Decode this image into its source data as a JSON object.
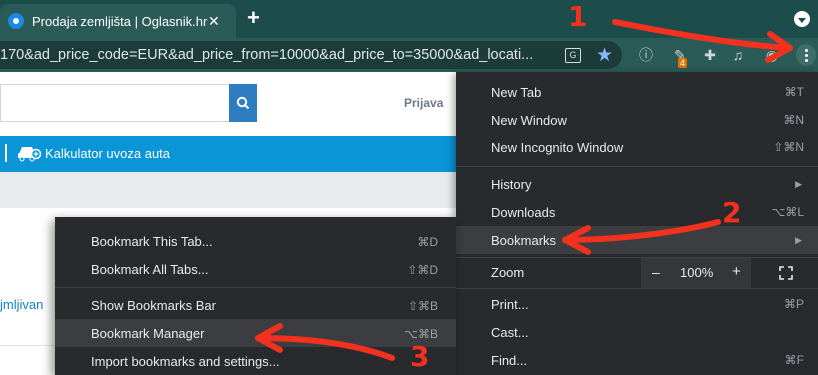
{
  "browser": {
    "tab_title": "Prodaja zemljišta | Oglasnik.hr",
    "tab_close": "✕",
    "new_tab": "+",
    "url": "170&ad_price_code=EUR&ad_price_from=10000&ad_price_to=35000&ad_locati...",
    "extension_badge": "4",
    "icons": [
      "favicon-icon",
      "close-icon",
      "plus-icon",
      "tab-search-icon",
      "translate-icon",
      "star-icon",
      "extension-icon",
      "puzzle-icon",
      "playlist-icon",
      "profile-icon",
      "kebab-menu-icon"
    ]
  },
  "site": {
    "login_label": "Prijava",
    "calc_label": "Kalkulator uvoza auta",
    "link_text": "jmljivan"
  },
  "main_menu": {
    "items": [
      {
        "label": "New Tab",
        "shortcut": "⌘T"
      },
      {
        "label": "New Window",
        "shortcut": "⌘N"
      },
      {
        "label": "New Incognito Window",
        "shortcut": "⇧⌘N"
      },
      {
        "label": "History",
        "arrow": "▶"
      },
      {
        "label": "Downloads",
        "shortcut": "⌥⌘L"
      },
      {
        "label": "Bookmarks",
        "arrow": "▶"
      },
      {
        "label": "Print...",
        "shortcut": "⌘P"
      },
      {
        "label": "Cast..."
      },
      {
        "label": "Find...",
        "shortcut": "⌘F"
      }
    ],
    "zoom": {
      "label": "Zoom",
      "minus": "–",
      "value": "100%",
      "plus": "+"
    }
  },
  "bookmarks_menu": {
    "items": [
      {
        "label": "Bookmark This Tab...",
        "shortcut": "⌘D"
      },
      {
        "label": "Bookmark All Tabs...",
        "shortcut": "⇧⌘D"
      },
      {
        "label": "Show Bookmarks Bar",
        "shortcut": "⇧⌘B"
      },
      {
        "label": "Bookmark Manager",
        "shortcut": "⌥⌘B"
      },
      {
        "label": "Import bookmarks and settings..."
      }
    ]
  },
  "annotations": {
    "step1": "1",
    "step2": "2",
    "step3": "3",
    "color": "#f2321e"
  },
  "colors": {
    "tab_strip": "#1d4d4a",
    "toolbar": "#2b5b57",
    "menu_bg": "#292a2d",
    "menu_highlight": "#3c3d41",
    "site_blue": "#0a95d6"
  }
}
